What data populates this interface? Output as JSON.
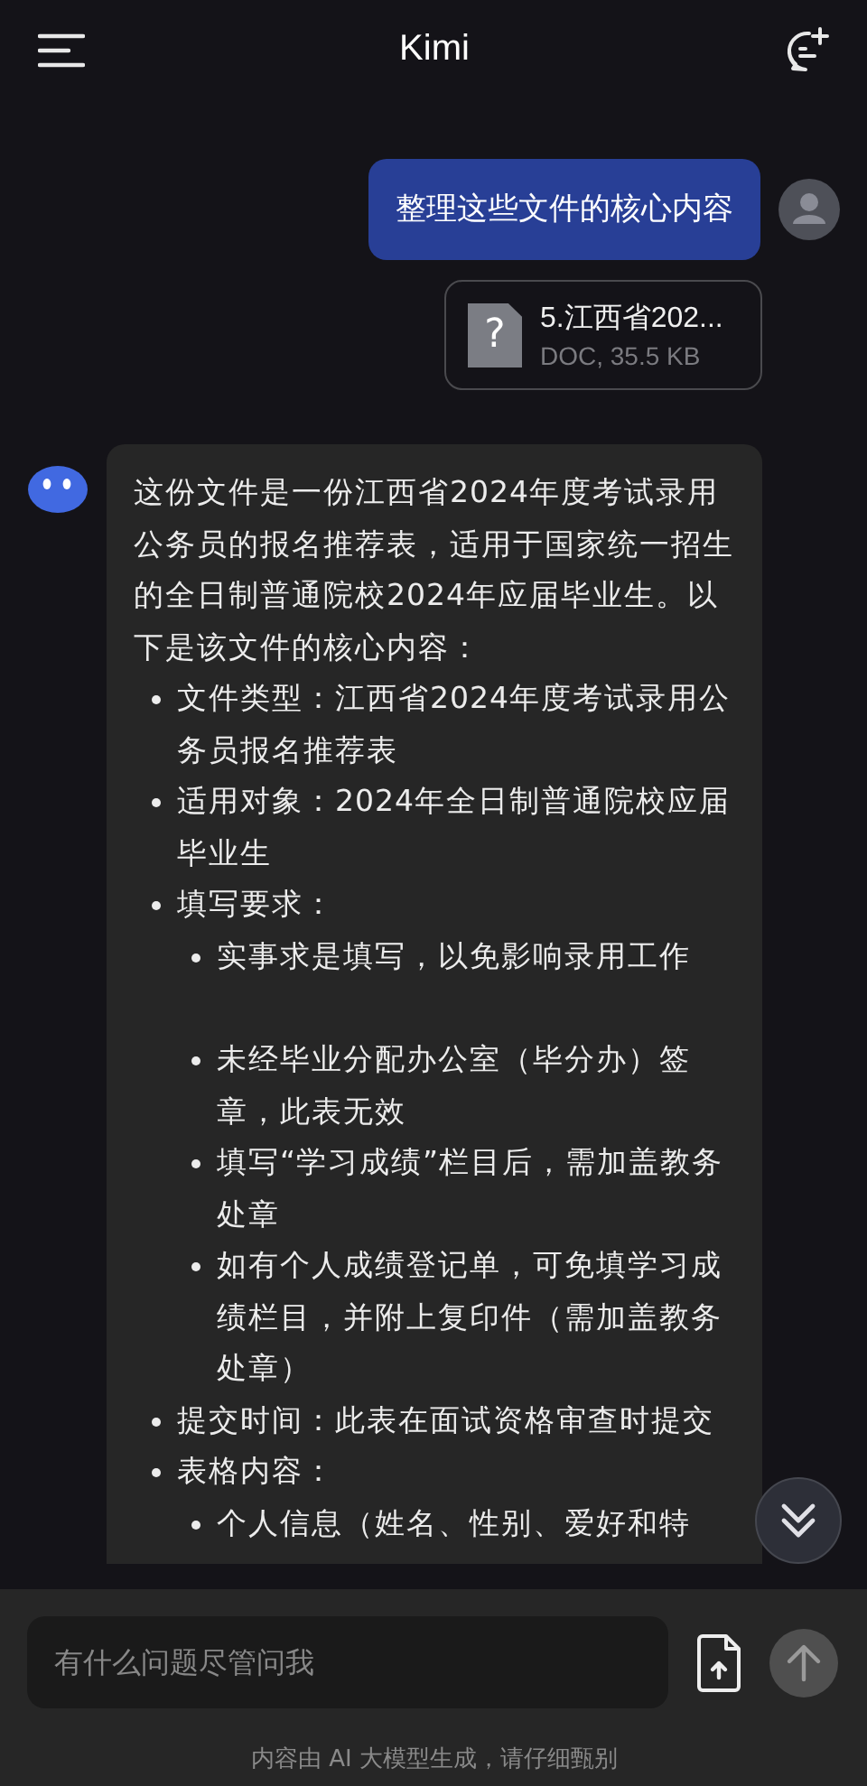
{
  "header": {
    "title": "Kimi"
  },
  "user_message": {
    "text": "整理这些文件的核心内容"
  },
  "attachment": {
    "icon_glyph": "?",
    "name": "5.江西省202...",
    "meta": "DOC, 35.5 KB"
  },
  "reply": {
    "intro": "这份文件是一份江西省2024年度考试录用公务员的报名推荐表，适用于国家统一招生的全日制普通院校2024年应届毕业生。以下是该文件的核心内容：",
    "items": [
      {
        "text": "文件类型：江西省2024年度考试录用公务员报名推荐表"
      },
      {
        "text": "适用对象：2024年全日制普通院校应届毕业生"
      },
      {
        "text": "填写要求：",
        "children": [
          {
            "text": "实事求是填写，以免影响录用工作",
            "gap_after": true
          },
          {
            "text": "未经毕业分配办公室（毕分办）签章，此表无效"
          },
          {
            "text": "填写“学习成绩”栏目后，需加盖教务处章"
          },
          {
            "text": "如有个人成绩登记单，可免填学习成绩栏目，并附上复印件（需加盖教务处章）"
          }
        ]
      },
      {
        "text": "提交时间：此表在面试资格审查时提交"
      },
      {
        "text": "表格内容：",
        "children": [
          {
            "text": "个人信息（姓名、性别、爱好和特"
          }
        ]
      }
    ]
  },
  "composer": {
    "placeholder": "有什么问题尽管问我",
    "send_disabled": true
  },
  "disclaimer": "内容由 AI 大模型生成，请仔细甄别"
}
